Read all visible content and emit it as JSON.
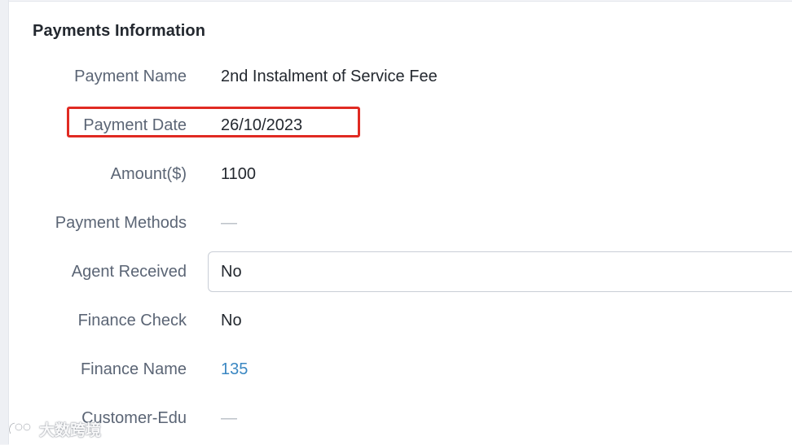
{
  "section": {
    "title": "Payments Information"
  },
  "fields": [
    {
      "label": "Payment Name",
      "value": "2nd Instalment of Service Fee"
    },
    {
      "label": "Payment Date",
      "value": "26/10/2023"
    },
    {
      "label": "Amount($)",
      "value": "1100"
    },
    {
      "label": "Payment Methods",
      "value": "—"
    },
    {
      "label": "Agent Received",
      "value": "No"
    },
    {
      "label": "Finance Check",
      "value": "No"
    },
    {
      "label": "Finance Name",
      "value": "135"
    },
    {
      "label": "Customer-Edu",
      "value": "—"
    }
  ],
  "annotation": {
    "highlight_color": "#e02a22"
  },
  "watermark": {
    "text": "大数跨境",
    "icon": "watermark-logo-icon"
  },
  "colors": {
    "label": "#5b6575",
    "value": "#23282f",
    "link": "#3a87c2"
  }
}
